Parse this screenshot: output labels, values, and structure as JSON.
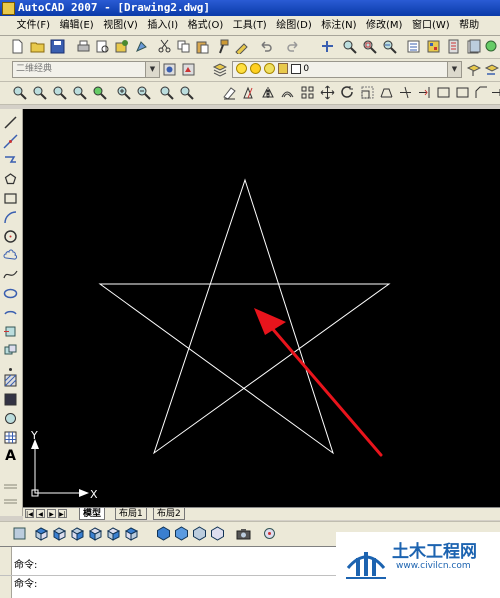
{
  "window": {
    "title": "AutoCAD 2007 - [Drawing2.dwg]"
  },
  "menu": [
    "文件(F)",
    "编辑(E)",
    "视图(V)",
    "插入(I)",
    "格式(O)",
    "工具(T)",
    "绘图(D)",
    "标注(N)",
    "修改(M)",
    "窗口(W)",
    "帮助"
  ],
  "workspace": {
    "value": "二维经典"
  },
  "layer": {
    "value": "0"
  },
  "tabs": [
    "模型",
    "布局1",
    "布局2"
  ],
  "ucs": {
    "x_label": "X",
    "y_label": "Y"
  },
  "command": {
    "prompt1": "命令:",
    "prompt2": "命令:"
  },
  "watermark": {
    "site_name": "土木工程网",
    "url": "www.civilcn.com"
  },
  "colors": {
    "canvas": "#000000",
    "geometry": "#ffffff",
    "arrow": "#e8141c",
    "title_bar": "#0a3aa8",
    "watermark": "#1c63b0"
  }
}
